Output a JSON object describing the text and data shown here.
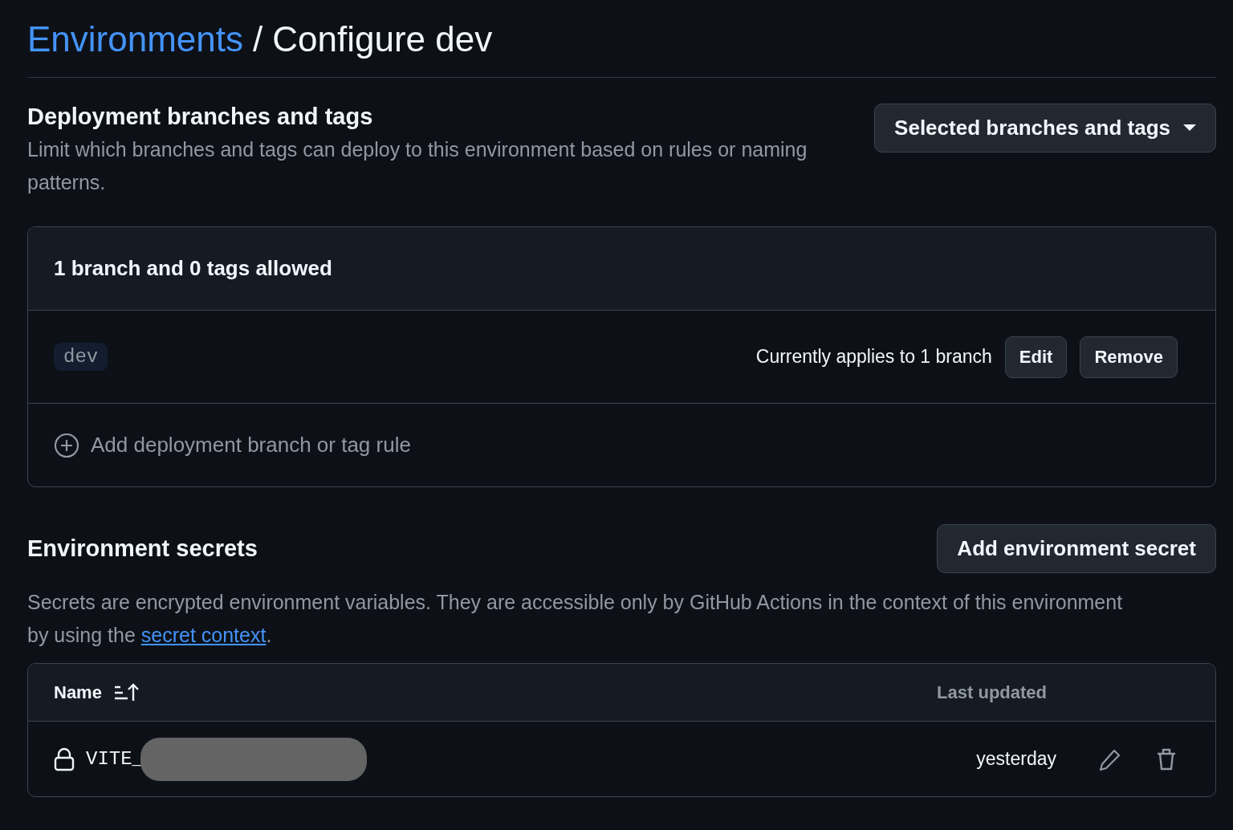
{
  "breadcrumb": {
    "link": "Environments",
    "separator": "/",
    "current": "Configure dev"
  },
  "deployment": {
    "title": "Deployment branches and tags",
    "description": "Limit which branches and tags can deploy to this environment based on rules or naming patterns.",
    "dropdown": "Selected branches and tags",
    "box": {
      "header": "1 branch and 0 tags allowed",
      "rules": [
        {
          "pattern": "dev",
          "applies": "Currently applies to 1 branch",
          "buttons": [
            "Edit",
            "Remove"
          ]
        }
      ],
      "add_rule": "Add deployment branch or tag rule"
    }
  },
  "secrets": {
    "title": "Environment secrets",
    "button": "Add environment secret",
    "description_before": "Secrets are encrypted environment variables. They are accessible only by GitHub Actions in the context of this environment by using the ",
    "link": "secret context",
    "description_after": ".",
    "table": {
      "columns": [
        "Name",
        "Last updated"
      ],
      "rows": [
        {
          "name": "VITE_",
          "redacted": true,
          "updated": "yesterday"
        }
      ]
    }
  }
}
